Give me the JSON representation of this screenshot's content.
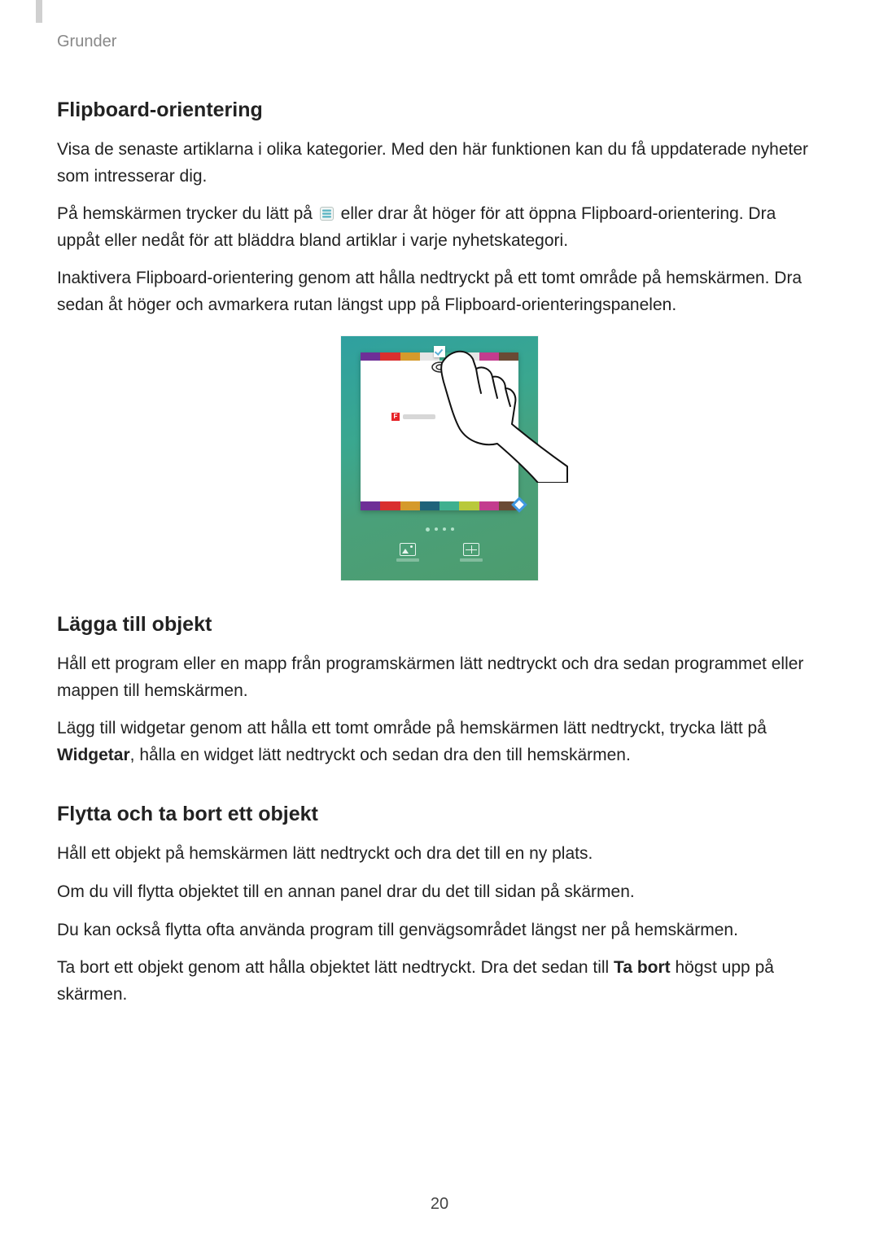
{
  "header": {
    "chapter": "Grunder"
  },
  "page_number": "20",
  "sections": {
    "flipboard": {
      "heading": "Flipboard-orientering",
      "p1": "Visa de senaste artiklarna i olika kategorier. Med den här funktionen kan du få uppdaterade nyheter som intresserar dig.",
      "p2a": "På hemskärmen trycker du lätt på ",
      "p2b": " eller drar åt höger för att öppna Flipboard-orientering. Dra uppåt eller nedåt för att bläddra bland artiklar i varje nyhetskategori.",
      "p3": "Inaktivera Flipboard-orientering genom att hålla nedtryckt på ett tomt område på hemskärmen. Dra sedan åt höger och avmarkera rutan längst upp på Flipboard-orienteringspanelen."
    },
    "add": {
      "heading": "Lägga till objekt",
      "p1": "Håll ett program eller en mapp från programskärmen lätt nedtryckt och dra sedan programmet eller mappen till hemskärmen.",
      "p2a": "Lägg till widgetar genom att hålla ett tomt område på hemskärmen lätt nedtryckt, trycka lätt på ",
      "p2_bold": "Widgetar",
      "p2b": ", hålla en widget lätt nedtryckt och sedan dra den till hemskärmen."
    },
    "move": {
      "heading": "Flytta och ta bort ett objekt",
      "p1": "Håll ett objekt på hemskärmen lätt nedtryckt och dra det till en ny plats.",
      "p2": "Om du vill flytta objektet till en annan panel drar du det till sidan på skärmen.",
      "p3": "Du kan också flytta ofta använda program till genvägsområdet längst ner på hemskärmen.",
      "p4a": "Ta bort ett objekt genom att hålla objektet lätt nedtryckt. Dra det sedan till ",
      "p4_bold": "Ta bort",
      "p4b": " högst upp på skärmen."
    }
  },
  "figure": {
    "alt": "Tablet-hemskärm i redigeringsläge med Flipboard-panel och en hand som pekar på kryssrutan",
    "briefing_letter": "F",
    "colors_top": [
      "#6e2f97",
      "#d92f2e",
      "#d59a2b",
      "#e5e5e5",
      "#3fb08f",
      "#e5e5e5",
      "#c33c8e",
      "#6a4a34"
    ],
    "colors_bottom": [
      "#6e2f97",
      "#d92f2e",
      "#d59a2b",
      "#1f627a",
      "#3fb08f",
      "#b9c93b",
      "#c33c8e",
      "#6a4a34"
    ]
  }
}
